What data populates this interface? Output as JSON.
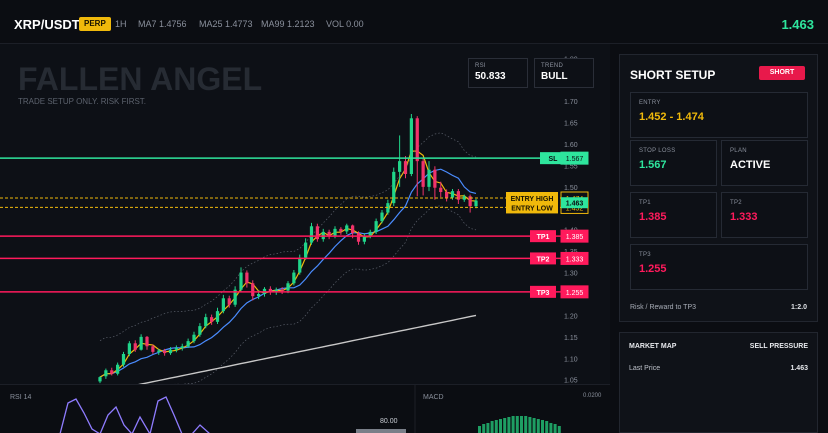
{
  "topbar": {
    "symbol": "XRP/USDT",
    "badge": "PERP",
    "timeframe": "1H",
    "ma7": "MA7 1.4756",
    "ma25": "MA25 1.4773",
    "ma99": "MA99 1.2123",
    "vol": "VOL 0.00",
    "price": "1.463"
  },
  "watermark": {
    "title": "FALLEN ANGEL",
    "subtitle": "TRADE SETUP ONLY. RISK FIRST."
  },
  "indicators": {
    "rsi_label": "RSI",
    "rsi_value": "50.833",
    "trend_label": "TREND",
    "trend_value": "BULL"
  },
  "colors": {
    "up": "#20d58a",
    "down": "#f0336b",
    "sl": "#2ee59d",
    "tp": "#ff1a5c",
    "entry": "#f0b90b",
    "ma_fast": "#f0b90b",
    "ma_mid": "#4a8cff",
    "ma_slow": "#c8c8c8"
  },
  "levels": [
    {
      "label": "SL",
      "value": 1.567,
      "text": "1.567",
      "kind": "sl"
    },
    {
      "label": "ENTRY HIGH",
      "value": 1.474,
      "text": "1.474",
      "kind": "entry"
    },
    {
      "label": "ENTRY LOW",
      "value": 1.452,
      "text": "1.452",
      "kind": "entry"
    },
    {
      "label": "TP1",
      "value": 1.385,
      "text": "1.385",
      "kind": "tp"
    },
    {
      "label": "TP2",
      "value": 1.333,
      "text": "1.333",
      "kind": "tp"
    },
    {
      "label": "TP3",
      "value": 1.255,
      "text": "1.255",
      "kind": "tp"
    }
  ],
  "current_price": {
    "value": 1.463,
    "text": "1.463"
  },
  "chart_data": {
    "type": "candlestick",
    "title": "",
    "ylim": [
      1.04,
      1.81
    ],
    "y_ticks": [
      "1.80",
      "1.75",
      "1.70",
      "1.65",
      "1.60",
      "1.55",
      "1.50",
      "1.45",
      "1.40",
      "1.35",
      "1.30",
      "1.25",
      "1.20",
      "1.15",
      "1.10",
      "1.05"
    ],
    "candles": [
      [
        1.046,
        1.056,
        1.042,
        1.058
      ],
      [
        1.058,
        1.072,
        1.052,
        1.076
      ],
      [
        1.072,
        1.064,
        1.06,
        1.078
      ],
      [
        1.064,
        1.085,
        1.06,
        1.09
      ],
      [
        1.085,
        1.11,
        1.08,
        1.115
      ],
      [
        1.11,
        1.135,
        1.105,
        1.14
      ],
      [
        1.135,
        1.12,
        1.115,
        1.142
      ],
      [
        1.12,
        1.15,
        1.118,
        1.156
      ],
      [
        1.15,
        1.128,
        1.12,
        1.152
      ],
      [
        1.128,
        1.115,
        1.11,
        1.132
      ],
      [
        1.115,
        1.118,
        1.108,
        1.122
      ],
      [
        1.118,
        1.112,
        1.106,
        1.122
      ],
      [
        1.112,
        1.12,
        1.108,
        1.126
      ],
      [
        1.12,
        1.124,
        1.114,
        1.13
      ],
      [
        1.124,
        1.128,
        1.118,
        1.134
      ],
      [
        1.128,
        1.14,
        1.124,
        1.146
      ],
      [
        1.14,
        1.155,
        1.135,
        1.162
      ],
      [
        1.155,
        1.175,
        1.15,
        1.182
      ],
      [
        1.175,
        1.196,
        1.17,
        1.204
      ],
      [
        1.196,
        1.185,
        1.178,
        1.202
      ],
      [
        1.185,
        1.21,
        1.18,
        1.218
      ],
      [
        1.21,
        1.24,
        1.205,
        1.248
      ],
      [
        1.24,
        1.225,
        1.218,
        1.246
      ],
      [
        1.225,
        1.26,
        1.22,
        1.268
      ],
      [
        1.26,
        1.3,
        1.255,
        1.312
      ],
      [
        1.3,
        1.275,
        1.265,
        1.305
      ],
      [
        1.275,
        1.245,
        1.235,
        1.282
      ],
      [
        1.245,
        1.25,
        1.238,
        1.258
      ],
      [
        1.25,
        1.262,
        1.244,
        1.266
      ],
      [
        1.262,
        1.255,
        1.248,
        1.268
      ],
      [
        1.255,
        1.26,
        1.248,
        1.265
      ],
      [
        1.26,
        1.258,
        1.25,
        1.266
      ],
      [
        1.258,
        1.275,
        1.252,
        1.28
      ],
      [
        1.275,
        1.3,
        1.27,
        1.306
      ],
      [
        1.3,
        1.335,
        1.295,
        1.342
      ],
      [
        1.335,
        1.37,
        1.33,
        1.38
      ],
      [
        1.37,
        1.408,
        1.365,
        1.416
      ],
      [
        1.408,
        1.378,
        1.372,
        1.414
      ],
      [
        1.378,
        1.395,
        1.372,
        1.402
      ],
      [
        1.395,
        1.385,
        1.378,
        1.4
      ],
      [
        1.385,
        1.402,
        1.38,
        1.408
      ],
      [
        1.402,
        1.396,
        1.388,
        1.406
      ],
      [
        1.396,
        1.41,
        1.39,
        1.414
      ],
      [
        1.41,
        1.392,
        1.38,
        1.412
      ],
      [
        1.392,
        1.372,
        1.365,
        1.396
      ],
      [
        1.372,
        1.385,
        1.366,
        1.392
      ],
      [
        1.385,
        1.395,
        1.38,
        1.4
      ],
      [
        1.395,
        1.42,
        1.39,
        1.426
      ],
      [
        1.42,
        1.44,
        1.415,
        1.446
      ],
      [
        1.44,
        1.462,
        1.435,
        1.47
      ],
      [
        1.462,
        1.535,
        1.455,
        1.545
      ],
      [
        1.535,
        1.56,
        1.5,
        1.62
      ],
      [
        1.56,
        1.53,
        1.52,
        1.572
      ],
      [
        1.53,
        1.66,
        1.525,
        1.67
      ],
      [
        1.66,
        1.56,
        1.478,
        1.665
      ],
      [
        1.56,
        1.5,
        1.48,
        1.566
      ],
      [
        1.5,
        1.54,
        1.49,
        1.56
      ],
      [
        1.54,
        1.498,
        1.47,
        1.548
      ],
      [
        1.498,
        1.488,
        1.476,
        1.512
      ],
      [
        1.488,
        1.475,
        1.466,
        1.494
      ],
      [
        1.475,
        1.49,
        1.47,
        1.495
      ],
      [
        1.49,
        1.47,
        1.46,
        1.495
      ],
      [
        1.47,
        1.478,
        1.465,
        1.482
      ],
      [
        1.478,
        1.455,
        1.44,
        1.482
      ],
      [
        1.455,
        1.468,
        1.45,
        1.472
      ]
    ]
  },
  "sub": {
    "rsi_title": "RSI 14",
    "rsi_level": "80.00",
    "macd_title": "MACD",
    "macd_value": "0.0200"
  },
  "panel": {
    "title": "SHORT SETUP",
    "badge": "SHORT",
    "entry_label": "ENTRY",
    "entry_value": "1.452 - 1.474",
    "sl_label": "STOP LOSS",
    "sl_value": "1.567",
    "plan_label": "PLAN",
    "plan_value": "ACTIVE",
    "tp1_label": "TP1",
    "tp1_value": "1.385",
    "tp2_label": "TP2",
    "tp2_value": "1.333",
    "tp3_label": "TP3",
    "tp3_value": "1.255",
    "rr_label": "Risk / Reward to TP3",
    "rr_value": "1:2.0"
  },
  "market_map": {
    "title": "MARKET MAP",
    "right_title": "SELL PRESSURE",
    "last_price_label": "Last Price",
    "last_price_value": "1.463"
  }
}
